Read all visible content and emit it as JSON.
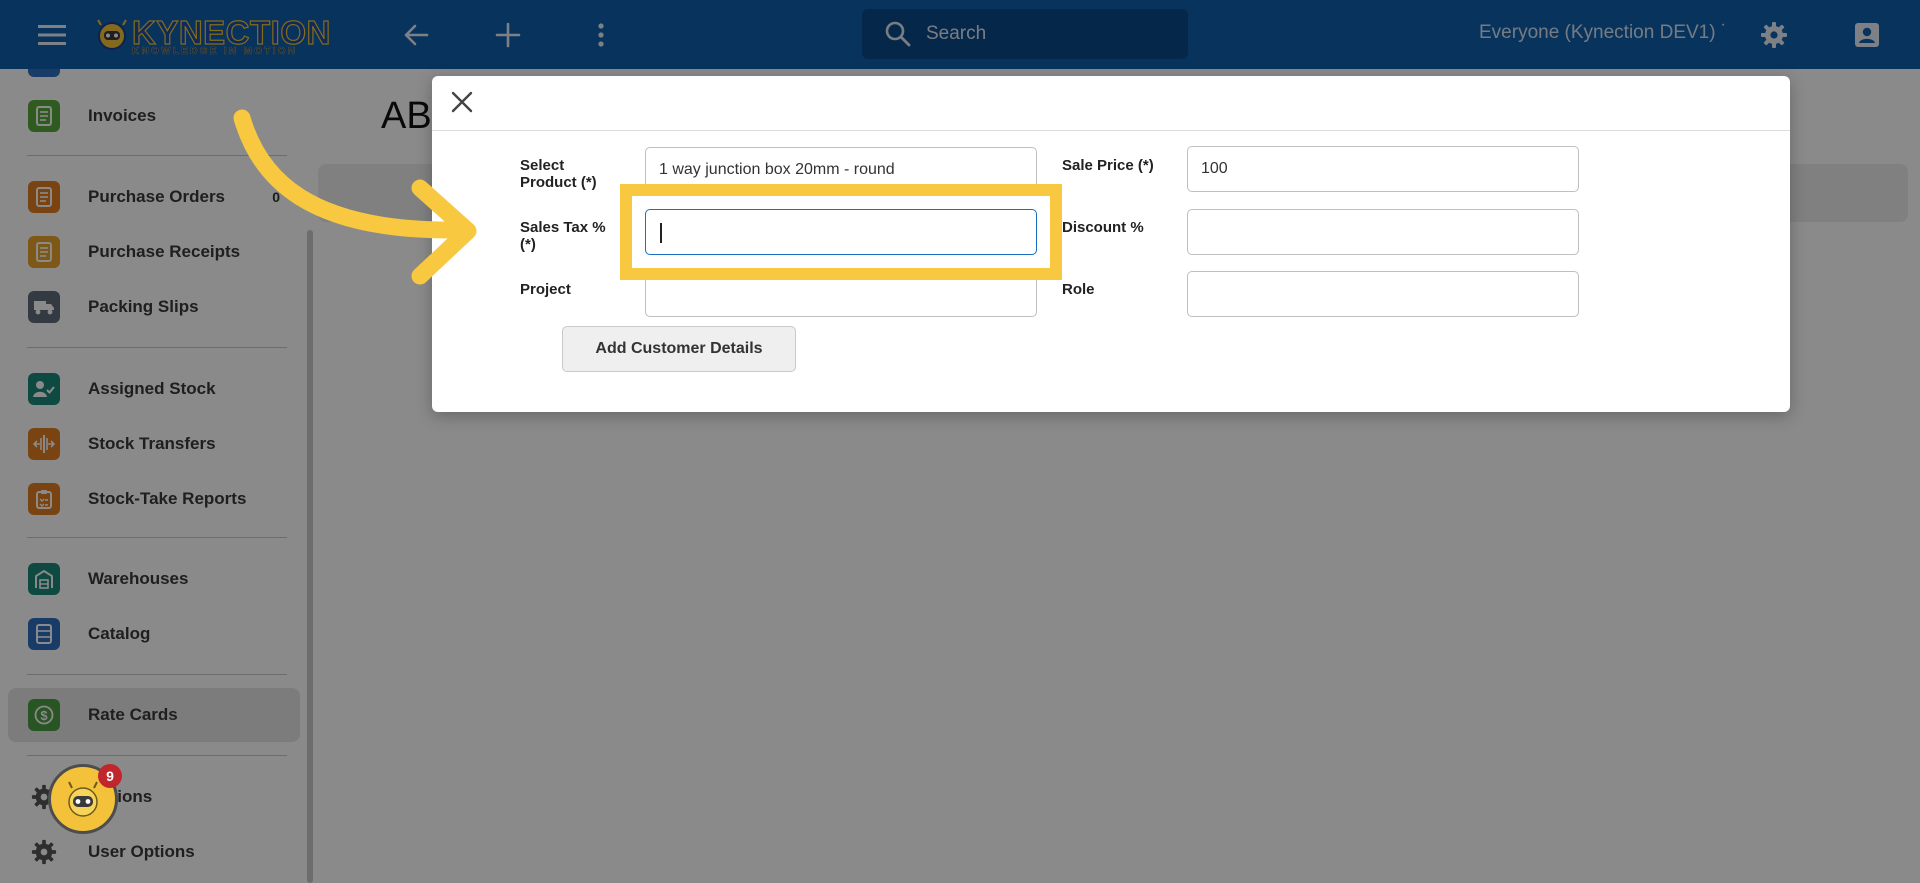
{
  "topbar": {
    "logo_name": "KYNECTION",
    "logo_tagline": "KNOWLEDGE IN MOTION",
    "search_label": "Search",
    "account_label": "Everyone (Kynection DEV1) ˙",
    "color": "#0f5fad"
  },
  "sidebar": {
    "items": [
      {
        "label": "Invoices",
        "icon": "invoice-icon",
        "color": "#5aa93b"
      },
      {
        "label": "Purchase Orders",
        "icon": "purchase-order-icon",
        "color": "#e07d22",
        "count": "0"
      },
      {
        "label": "Purchase Receipts",
        "icon": "receipt-icon",
        "color": "#e8a32a"
      },
      {
        "label": "Packing Slips",
        "icon": "truck-icon",
        "color": "#5e6b7a"
      },
      {
        "label": "Assigned Stock",
        "icon": "assigned-user-icon",
        "color": "#1d8a7a"
      },
      {
        "label": "Stock Transfers",
        "icon": "transfer-icon",
        "color": "#e07d22"
      },
      {
        "label": "Stock-Take Reports",
        "icon": "clipboard-icon",
        "color": "#e07d22"
      },
      {
        "label": "Warehouses",
        "icon": "warehouse-icon",
        "color": "#1d8a7a"
      },
      {
        "label": "Catalog",
        "icon": "catalog-icon",
        "color": "#2e6fbf"
      },
      {
        "label": "Rate Cards",
        "icon": "dollar-icon",
        "color": "#4c9c43"
      },
      {
        "label": "Options",
        "icon": "gear-icon",
        "color": "#555555"
      },
      {
        "label": "User Options",
        "icon": "gear-icon",
        "color": "#555555"
      }
    ]
  },
  "main": {
    "title": "AB"
  },
  "modal": {
    "fields": {
      "product_label": "Select Product (*)",
      "product_value": "1 way junction box 20mm - round",
      "sale_price_label": "Sale Price (*)",
      "sale_price_value": "100",
      "sales_tax_label": "Sales Tax % (*)",
      "sales_tax_value": "",
      "discount_label": "Discount %",
      "discount_value": "",
      "project_label": "Project",
      "project_value": "",
      "role_label": "Role",
      "role_value": ""
    },
    "add_customer_label": "Add Customer Details"
  },
  "help_widget": {
    "badge_count": "9"
  },
  "colors": {
    "highlight": "#f8c840",
    "focus": "#1b6ec2"
  }
}
